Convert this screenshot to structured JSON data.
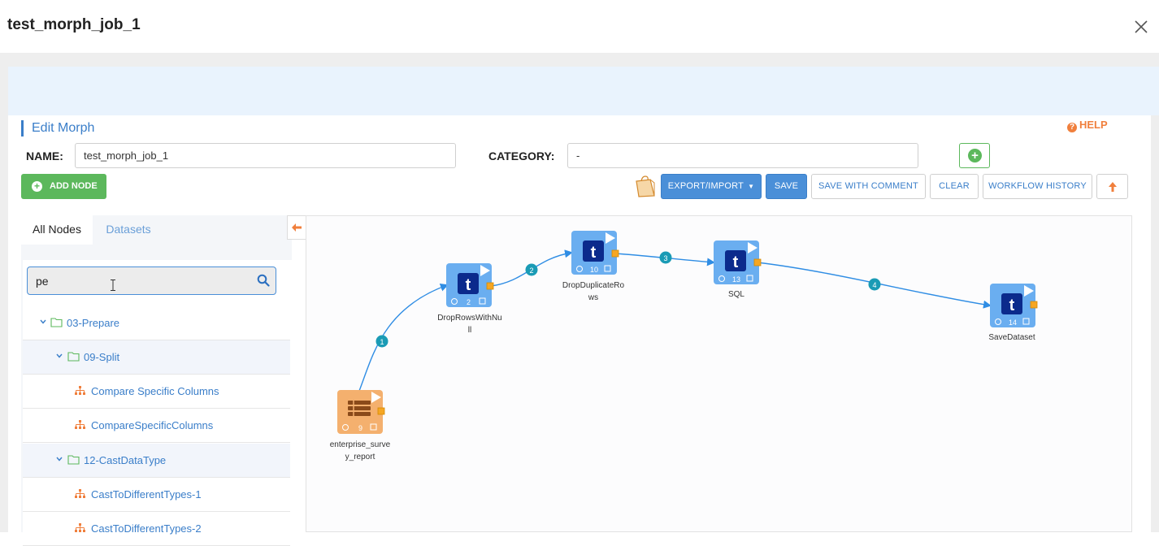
{
  "modal": {
    "title": "test_morph_job_1"
  },
  "editor": {
    "section_title": "Edit Morph",
    "help_label": "HELP",
    "name_label": "NAME:",
    "name_value": "test_morph_job_1",
    "category_label": "CATEGORY:",
    "category_value": "-"
  },
  "toolbar": {
    "add_node": "ADD NODE",
    "export_import": "EXPORT/IMPORT",
    "save": "SAVE",
    "save_with_comment": "SAVE WITH COMMENT",
    "clear": "CLEAR",
    "workflow_history": "WORKFLOW HISTORY"
  },
  "sidebar": {
    "tabs": [
      "All Nodes",
      "Datasets"
    ],
    "search_value": "pe",
    "tree": [
      {
        "label": "03-Prepare",
        "kind": "folder",
        "level": 0
      },
      {
        "label": "09-Split",
        "kind": "folder",
        "level": 1
      },
      {
        "label": "Compare Specific Columns",
        "kind": "node",
        "level": 2
      },
      {
        "label": "CompareSpecificColumns",
        "kind": "node",
        "level": 2
      },
      {
        "label": "12-CastDataType",
        "kind": "folder",
        "level": 1
      },
      {
        "label": "CastToDifferentTypes-1",
        "kind": "node",
        "level": 2
      },
      {
        "label": "CastToDifferentTypes-2",
        "kind": "node",
        "level": 2
      }
    ]
  },
  "canvas": {
    "nodes": [
      {
        "id": "9",
        "label_line1": "enterprise_surve",
        "label_line2": "y_report",
        "kind": "dataset",
        "color": "#f4b06e"
      },
      {
        "id": "2",
        "label_line1": "DropRowsWithNu",
        "label_line2": "ll",
        "kind": "transform",
        "color": "#6aaef0"
      },
      {
        "id": "10",
        "label_line1": "DropDuplicateRo",
        "label_line2": "ws",
        "kind": "transform",
        "color": "#6aaef0"
      },
      {
        "id": "13",
        "label_line1": "SQL",
        "label_line2": "",
        "kind": "transform",
        "color": "#6aaef0"
      },
      {
        "id": "14",
        "label_line1": "SaveDataset",
        "label_line2": "",
        "kind": "transform",
        "color": "#6aaef0"
      }
    ],
    "edges": [
      "1",
      "2",
      "3",
      "4"
    ]
  },
  "colors": {
    "accent_blue": "#4a8fd8",
    "green": "#5cb85c",
    "orange": "#f07f3c",
    "edge_badge": "#1a9bb5",
    "edge_line": "#2f8de4"
  }
}
